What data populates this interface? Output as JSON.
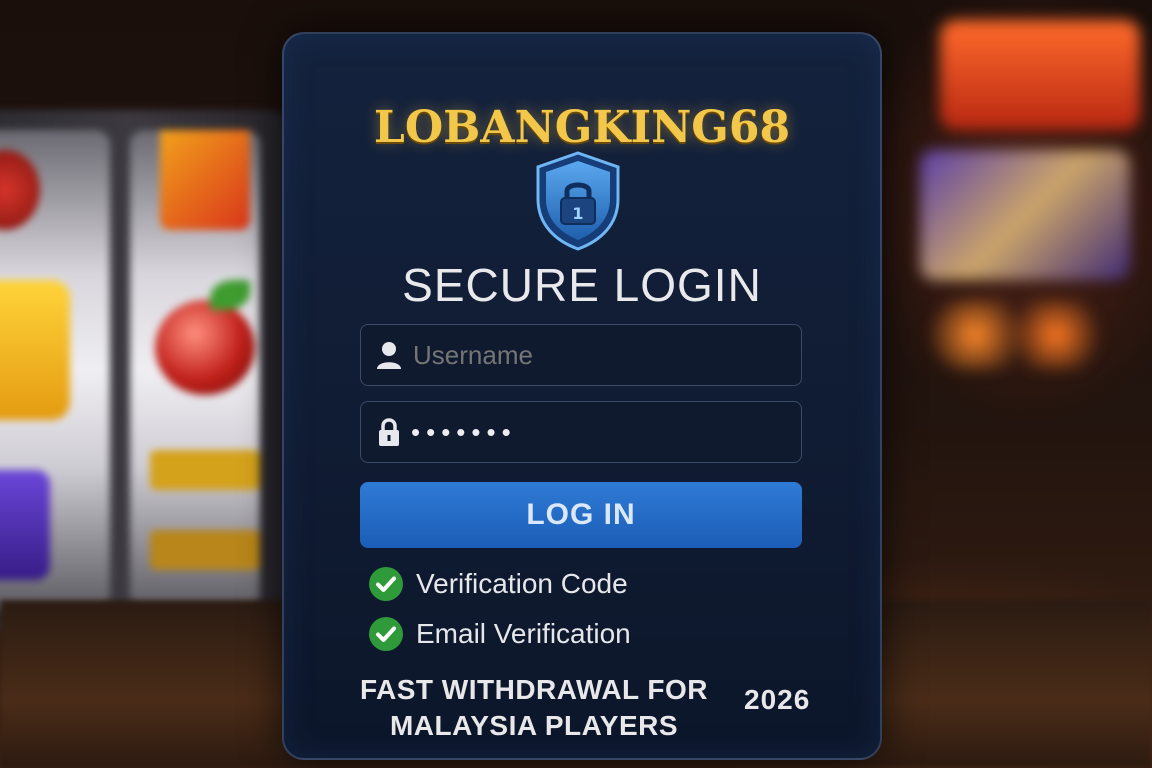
{
  "brand": {
    "name": "LOBANGKING68",
    "color": "#f3c84a"
  },
  "header": {
    "title": "SECURE LOGIN",
    "icon": "shield-lock-icon"
  },
  "form": {
    "username": {
      "placeholder": "Username",
      "icon": "user-icon"
    },
    "password": {
      "value": "•••••••",
      "icon": "lock-icon"
    },
    "login_button": {
      "label": "LOG IN",
      "color": "#2f7bd6"
    }
  },
  "features": [
    {
      "label": "Verification Code",
      "icon": "check-circle-icon"
    },
    {
      "label": "Email Verification",
      "icon": "check-circle-icon"
    }
  ],
  "footer": {
    "promo_line1": "FAST WITHDRAWAL FOR",
    "promo_line2": "MALAYSIA PLAYERS",
    "year": "2026"
  }
}
